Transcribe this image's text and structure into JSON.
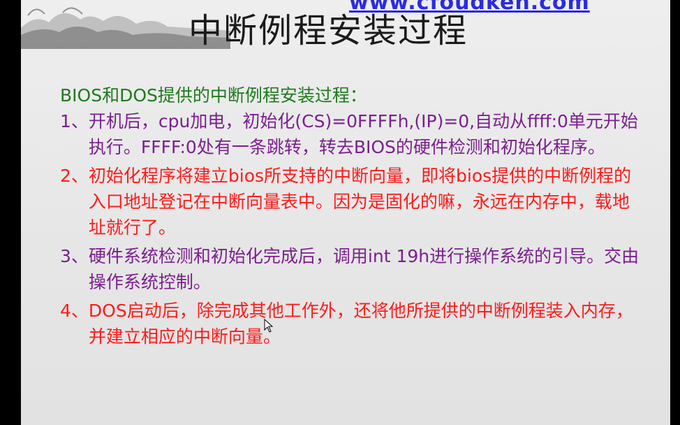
{
  "watermark": "www.cfoudken.com",
  "title": "中断例程安装过程",
  "subtitle": "BIOS和DOS提供的中断例程安装过程：",
  "items": [
    {
      "num": "1、",
      "text": "开机后，cpu加电，初始化(CS)=0FFFFh,(IP)=0,自动从ffff:0单元开始执行。FFFF:0处有一条跳转，转去BIOS的硬件检测和初始化程序。"
    },
    {
      "num": "2、",
      "text": "初始化程序将建立bios所支持的中断向量，即将bios提供的中断例程的入口地址登记在中断向量表中。因为是固化的嘛，永远在内存中，载地址就行了。"
    },
    {
      "num": "3、",
      "text": "硬件系统检测和初始化完成后，调用int 19h进行操作系统的引导。交由操作系统控制。"
    },
    {
      "num": "4、",
      "text": "DOS启动后，除完成其他工作外，还将他所提供的中断例程装入内存，并建立相应的中断向量。"
    }
  ],
  "colors": {
    "background": "#e8e8e8",
    "subtitle": "#1f7a1f",
    "purple": "#7b1f8e",
    "red": "#ff1a1a",
    "watermark": "#2b2be0"
  },
  "icons": [
    "ink-mountain-decoration",
    "mouse-pointer-icon"
  ]
}
